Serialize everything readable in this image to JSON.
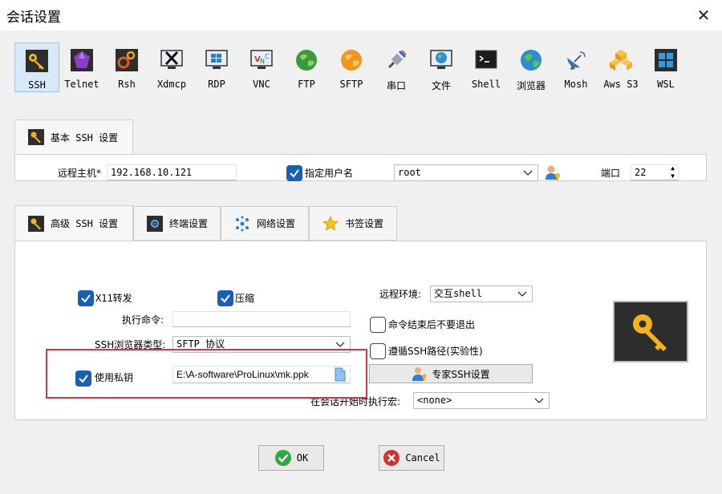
{
  "window": {
    "title": "会话设置",
    "close_glyph": "✕"
  },
  "protocols": [
    {
      "label": "SSH",
      "icon": "key-icon",
      "active": true
    },
    {
      "label": "Telnet",
      "icon": "gem-icon"
    },
    {
      "label": "Rsh",
      "icon": "gears-icon"
    },
    {
      "label": "Xdmcp",
      "icon": "x-monitor-icon"
    },
    {
      "label": "RDP",
      "icon": "windows-monitor-icon"
    },
    {
      "label": "VNC",
      "icon": "vnc-monitor-icon"
    },
    {
      "label": "FTP",
      "icon": "globe-icon"
    },
    {
      "label": "SFTP",
      "icon": "globe-orange-icon"
    },
    {
      "label": "串口",
      "icon": "satellite-icon"
    },
    {
      "label": "文件",
      "icon": "globe-monitor-icon"
    },
    {
      "label": "Shell",
      "icon": "terminal-icon"
    },
    {
      "label": "浏览器",
      "icon": "earth-icon"
    },
    {
      "label": "Mosh",
      "icon": "dish-icon"
    },
    {
      "label": "Aws S3",
      "icon": "cubes-icon"
    },
    {
      "label": "WSL",
      "icon": "windows-icon"
    }
  ],
  "basic": {
    "tab_label": "基本 SSH 设置",
    "remote_host_label": "远程主机*",
    "remote_host_value": "192.168.10.121",
    "specify_user_label": "指定用户名",
    "username_value": "root",
    "port_label": "端口",
    "port_value": "22"
  },
  "advanced_tabs": [
    {
      "label": "高级 SSH 设置",
      "icon": "key-icon",
      "active": true
    },
    {
      "label": "终端设置",
      "icon": "terminal-gear-icon"
    },
    {
      "label": "网络设置",
      "icon": "network-icon"
    },
    {
      "label": "书签设置",
      "icon": "star-icon"
    }
  ],
  "advanced": {
    "x11_label": "X11转发",
    "compress_label": "压缩",
    "exec_cmd_label": "执行命令:",
    "exec_cmd_value": "",
    "ssh_browser_label": "SSH浏览器类型:",
    "ssh_browser_value": "SFTP 协议",
    "private_key_label": "使用私钥",
    "private_key_value": "E:\\A-software\\ProLinux\\mk.ppk",
    "remote_env_label": "远程环境:",
    "remote_env_value": "交互shell",
    "no_exit_label": "命令结束后不要退出",
    "follow_path_label": "遵循SSH路径(实验性)",
    "expert_button": "专家SSH设置",
    "macro_label": "在会话开始时执行宏:",
    "macro_value": "<none>"
  },
  "buttons": {
    "ok": "OK",
    "cancel": "Cancel"
  },
  "colors": {
    "accent": "#1a5fb4",
    "highlight": "#d9363e",
    "ok_green": "#2eaa3f",
    "cancel_red": "#d0322d"
  }
}
